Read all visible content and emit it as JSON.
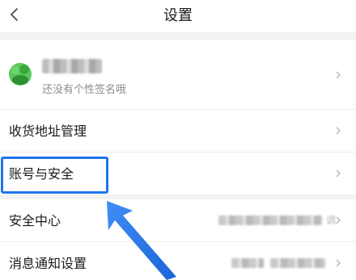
{
  "nav": {
    "title": "设置",
    "back_icon": "chevron-left-icon"
  },
  "profile": {
    "signature": "还没有个性签名哦",
    "avatar_color": "#47c24a"
  },
  "rows": [
    {
      "label": "收货地址管理"
    },
    {
      "label": "账号与安全"
    },
    {
      "label": "安全中心",
      "value_suffix": "调"
    },
    {
      "label": "消息通知设置"
    }
  ],
  "annotation": {
    "highlight_color": "#1f74ee"
  }
}
